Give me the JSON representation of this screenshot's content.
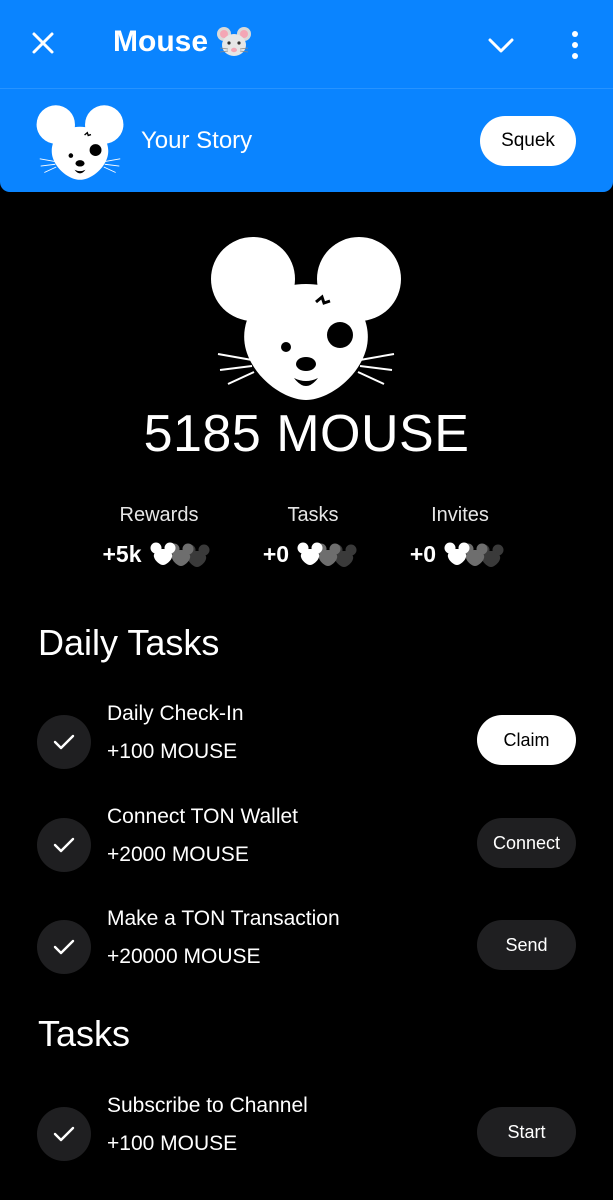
{
  "header": {
    "title": "Mouse",
    "title_icon": "mouse-face-emoji",
    "close_icon": "close-icon",
    "collapse_icon": "chevron-down-icon",
    "more_icon": "more-vertical-icon",
    "background": "#0a84ff"
  },
  "story": {
    "label": "Your Story",
    "avatar_icon": "mouse-logo-icon",
    "button_label": "Squek"
  },
  "balance": {
    "text": "5185 MOUSE"
  },
  "stats": [
    {
      "label": "Rewards",
      "value": "+5k",
      "icon": "mouse-trio-icon"
    },
    {
      "label": "Tasks",
      "value": "+0",
      "icon": "mouse-trio-icon"
    },
    {
      "label": "Invites",
      "value": "+0",
      "icon": "mouse-trio-icon"
    }
  ],
  "daily_tasks": {
    "title": "Daily Tasks",
    "items": [
      {
        "name": "Daily Check-In",
        "reward": "+100 MOUSE",
        "button": "Claim",
        "button_style": "primary"
      },
      {
        "name": "Connect TON Wallet",
        "reward": "+2000 MOUSE",
        "button": "Connect",
        "button_style": "secondary"
      },
      {
        "name": "Make a TON Transaction",
        "reward": "+20000 MOUSE",
        "button": "Send",
        "button_style": "secondary"
      }
    ]
  },
  "tasks": {
    "title": "Tasks",
    "items": [
      {
        "name": "Subscribe to Channel",
        "reward": "+100 MOUSE",
        "button": "Start",
        "button_style": "secondary"
      }
    ]
  }
}
